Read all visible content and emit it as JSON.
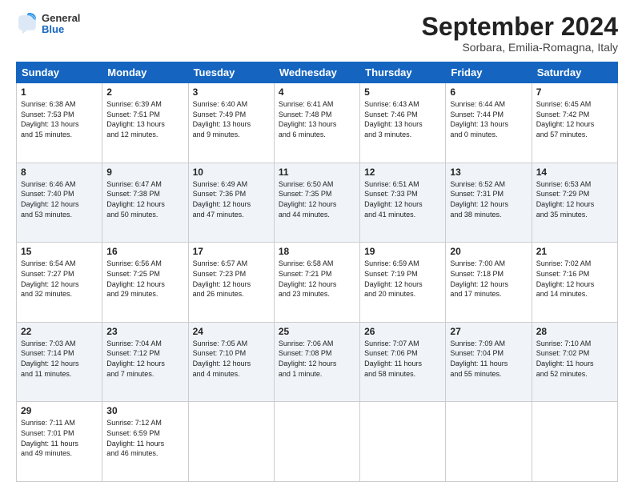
{
  "header": {
    "logo_general": "General",
    "logo_blue": "Blue",
    "month_title": "September 2024",
    "location": "Sorbara, Emilia-Romagna, Italy"
  },
  "days_of_week": [
    "Sunday",
    "Monday",
    "Tuesday",
    "Wednesday",
    "Thursday",
    "Friday",
    "Saturday"
  ],
  "weeks": [
    [
      {
        "day": "1",
        "lines": [
          "Sunrise: 6:38 AM",
          "Sunset: 7:53 PM",
          "Daylight: 13 hours",
          "and 15 minutes."
        ]
      },
      {
        "day": "2",
        "lines": [
          "Sunrise: 6:39 AM",
          "Sunset: 7:51 PM",
          "Daylight: 13 hours",
          "and 12 minutes."
        ]
      },
      {
        "day": "3",
        "lines": [
          "Sunrise: 6:40 AM",
          "Sunset: 7:49 PM",
          "Daylight: 13 hours",
          "and 9 minutes."
        ]
      },
      {
        "day": "4",
        "lines": [
          "Sunrise: 6:41 AM",
          "Sunset: 7:48 PM",
          "Daylight: 13 hours",
          "and 6 minutes."
        ]
      },
      {
        "day": "5",
        "lines": [
          "Sunrise: 6:43 AM",
          "Sunset: 7:46 PM",
          "Daylight: 13 hours",
          "and 3 minutes."
        ]
      },
      {
        "day": "6",
        "lines": [
          "Sunrise: 6:44 AM",
          "Sunset: 7:44 PM",
          "Daylight: 13 hours",
          "and 0 minutes."
        ]
      },
      {
        "day": "7",
        "lines": [
          "Sunrise: 6:45 AM",
          "Sunset: 7:42 PM",
          "Daylight: 12 hours",
          "and 57 minutes."
        ]
      }
    ],
    [
      {
        "day": "8",
        "lines": [
          "Sunrise: 6:46 AM",
          "Sunset: 7:40 PM",
          "Daylight: 12 hours",
          "and 53 minutes."
        ]
      },
      {
        "day": "9",
        "lines": [
          "Sunrise: 6:47 AM",
          "Sunset: 7:38 PM",
          "Daylight: 12 hours",
          "and 50 minutes."
        ]
      },
      {
        "day": "10",
        "lines": [
          "Sunrise: 6:49 AM",
          "Sunset: 7:36 PM",
          "Daylight: 12 hours",
          "and 47 minutes."
        ]
      },
      {
        "day": "11",
        "lines": [
          "Sunrise: 6:50 AM",
          "Sunset: 7:35 PM",
          "Daylight: 12 hours",
          "and 44 minutes."
        ]
      },
      {
        "day": "12",
        "lines": [
          "Sunrise: 6:51 AM",
          "Sunset: 7:33 PM",
          "Daylight: 12 hours",
          "and 41 minutes."
        ]
      },
      {
        "day": "13",
        "lines": [
          "Sunrise: 6:52 AM",
          "Sunset: 7:31 PM",
          "Daylight: 12 hours",
          "and 38 minutes."
        ]
      },
      {
        "day": "14",
        "lines": [
          "Sunrise: 6:53 AM",
          "Sunset: 7:29 PM",
          "Daylight: 12 hours",
          "and 35 minutes."
        ]
      }
    ],
    [
      {
        "day": "15",
        "lines": [
          "Sunrise: 6:54 AM",
          "Sunset: 7:27 PM",
          "Daylight: 12 hours",
          "and 32 minutes."
        ]
      },
      {
        "day": "16",
        "lines": [
          "Sunrise: 6:56 AM",
          "Sunset: 7:25 PM",
          "Daylight: 12 hours",
          "and 29 minutes."
        ]
      },
      {
        "day": "17",
        "lines": [
          "Sunrise: 6:57 AM",
          "Sunset: 7:23 PM",
          "Daylight: 12 hours",
          "and 26 minutes."
        ]
      },
      {
        "day": "18",
        "lines": [
          "Sunrise: 6:58 AM",
          "Sunset: 7:21 PM",
          "Daylight: 12 hours",
          "and 23 minutes."
        ]
      },
      {
        "day": "19",
        "lines": [
          "Sunrise: 6:59 AM",
          "Sunset: 7:19 PM",
          "Daylight: 12 hours",
          "and 20 minutes."
        ]
      },
      {
        "day": "20",
        "lines": [
          "Sunrise: 7:00 AM",
          "Sunset: 7:18 PM",
          "Daylight: 12 hours",
          "and 17 minutes."
        ]
      },
      {
        "day": "21",
        "lines": [
          "Sunrise: 7:02 AM",
          "Sunset: 7:16 PM",
          "Daylight: 12 hours",
          "and 14 minutes."
        ]
      }
    ],
    [
      {
        "day": "22",
        "lines": [
          "Sunrise: 7:03 AM",
          "Sunset: 7:14 PM",
          "Daylight: 12 hours",
          "and 11 minutes."
        ]
      },
      {
        "day": "23",
        "lines": [
          "Sunrise: 7:04 AM",
          "Sunset: 7:12 PM",
          "Daylight: 12 hours",
          "and 7 minutes."
        ]
      },
      {
        "day": "24",
        "lines": [
          "Sunrise: 7:05 AM",
          "Sunset: 7:10 PM",
          "Daylight: 12 hours",
          "and 4 minutes."
        ]
      },
      {
        "day": "25",
        "lines": [
          "Sunrise: 7:06 AM",
          "Sunset: 7:08 PM",
          "Daylight: 12 hours",
          "and 1 minute."
        ]
      },
      {
        "day": "26",
        "lines": [
          "Sunrise: 7:07 AM",
          "Sunset: 7:06 PM",
          "Daylight: 11 hours",
          "and 58 minutes."
        ]
      },
      {
        "day": "27",
        "lines": [
          "Sunrise: 7:09 AM",
          "Sunset: 7:04 PM",
          "Daylight: 11 hours",
          "and 55 minutes."
        ]
      },
      {
        "day": "28",
        "lines": [
          "Sunrise: 7:10 AM",
          "Sunset: 7:02 PM",
          "Daylight: 11 hours",
          "and 52 minutes."
        ]
      }
    ],
    [
      {
        "day": "29",
        "lines": [
          "Sunrise: 7:11 AM",
          "Sunset: 7:01 PM",
          "Daylight: 11 hours",
          "and 49 minutes."
        ]
      },
      {
        "day": "30",
        "lines": [
          "Sunrise: 7:12 AM",
          "Sunset: 6:59 PM",
          "Daylight: 11 hours",
          "and 46 minutes."
        ]
      },
      {
        "day": "",
        "lines": []
      },
      {
        "day": "",
        "lines": []
      },
      {
        "day": "",
        "lines": []
      },
      {
        "day": "",
        "lines": []
      },
      {
        "day": "",
        "lines": []
      }
    ]
  ]
}
